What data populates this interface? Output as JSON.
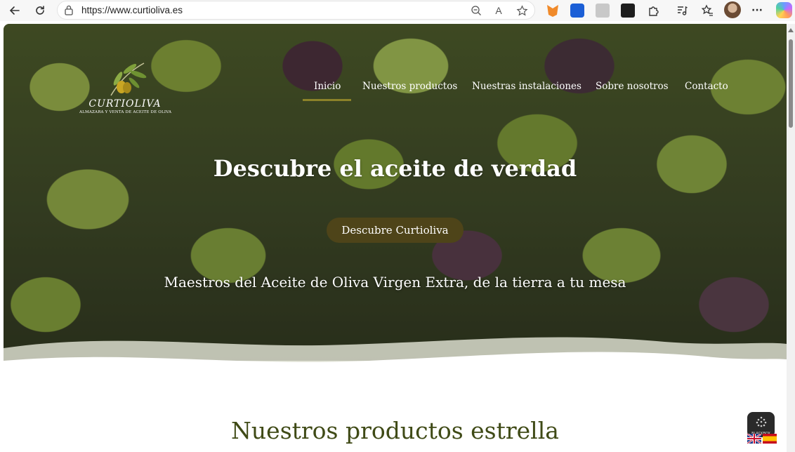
{
  "browser": {
    "url": "https://www.curtioliva.es",
    "icons": [
      "back-icon",
      "refresh-icon",
      "lock-icon",
      "zoom-out-icon",
      "read-aloud-icon",
      "favorite-star-icon",
      "metamask-extension-icon",
      "bitwarden-extension-icon",
      "collections-icon",
      "extension-icon",
      "extensions-puzzle-icon",
      "media-icon",
      "favorites-icon",
      "profile-avatar",
      "more-options-icon",
      "copilot-icon"
    ],
    "read_aloud_glyph": "A",
    "more_glyph": "···"
  },
  "site": {
    "logo": {
      "name": "CURTIOLIVA",
      "tagline": "ALMAZARA Y VENTA DE ACEITE DE OLIVA"
    },
    "nav": [
      {
        "label": "Inicio",
        "active": true
      },
      {
        "label": "Nuestros productos",
        "active": false
      },
      {
        "label": "Nuestras instalaciones",
        "active": false
      },
      {
        "label": "Sobre nosotros",
        "active": false
      },
      {
        "label": "Contacto",
        "active": false
      }
    ],
    "hero": {
      "title": "Descubre el aceite de verdad",
      "cta_label": "Descubre Curtioliva",
      "subtitle": "Maestros del Aceite de Oliva Virgen Extra, de la tierra a tu mesa"
    },
    "section_title": "Nuestros productos estrella",
    "widget_label": "BLACKBOX",
    "language_flags": [
      "flag-en-icon",
      "flag-es-icon"
    ]
  },
  "colors": {
    "nav_underline": "#8c8229",
    "cta_background": "#4e4419",
    "section_title": "#3f4a16"
  }
}
